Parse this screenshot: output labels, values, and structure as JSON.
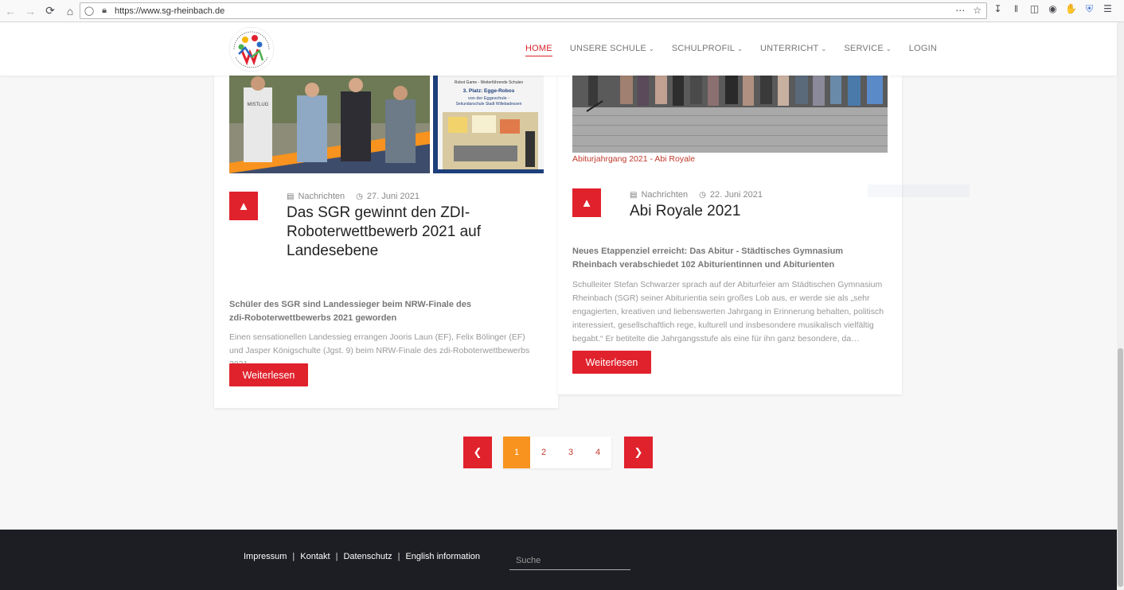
{
  "browser": {
    "url": "https://www.sg-rheinbach.de"
  },
  "nav": {
    "items": [
      {
        "label": "HOME",
        "active": true,
        "has_dropdown": false
      },
      {
        "label": "UNSERE SCHULE",
        "active": false,
        "has_dropdown": true
      },
      {
        "label": "SCHULPROFIL",
        "active": false,
        "has_dropdown": true
      },
      {
        "label": "UNTERRICHT",
        "active": false,
        "has_dropdown": true
      },
      {
        "label": "SERVICE",
        "active": false,
        "has_dropdown": true
      },
      {
        "label": "LOGIN",
        "active": false,
        "has_dropdown": false
      }
    ]
  },
  "articles": [
    {
      "category": "Nachrichten",
      "date": "27. Juni 2021",
      "title": "Das SGR gewinnt den ZDI-Roboterwettbewerb 2021 auf Landesebene",
      "lead": "Schüler des SGR sind Landessieger beim NRW-Finale des zdi-Roboterwettbewerbs 2021 geworden",
      "excerpt": "Einen sensationellen Landessieg errangen Jooris Laun (EF), Felix Bölinger (EF) und Jasper Königschulte (Jgst. 9) beim NRW-Finale des zdi-Roboterwettbewerbs 2021.",
      "button": "Weiterlesen",
      "image_caption": "",
      "poster_text": [
        "Robot Game - Weiterführende Schulen",
        "3. Platz: Egge-Robos",
        "von der Eggeschule -",
        "Sekundarschule Stadt Willebadessen"
      ],
      "shirt_text": "MISTLUG"
    },
    {
      "category": "Nachrichten",
      "date": "22. Juni 2021",
      "title": "Abi Royale 2021",
      "lead": "Neues Etappenziel erreicht: Das Abitur - Städtisches Gymnasium Rheinbach verabschiedet 102 Abiturientinnen und Abiturienten",
      "excerpt": "Schulleiter Stefan Schwarzer sprach auf der Abiturfeier am Städtischen Gymnasium Rheinbach (SGR) seiner Abiturientia sein großes Lob aus, er werde sie als „sehr engagierten, kreativen und liebenswerten Jahrgang in Erinnerung behalten, politisch interessiert, gesellschaftlich rege, kulturell und insbesondere musikalisch vielfältig begabt.“ Er betitelte die Jahrgangsstufe als eine für ihn ganz besondere, da…",
      "button": "Weiterlesen",
      "image_caption": "Abiturjahrgang 2021 - Abi Royale"
    }
  ],
  "pagination": {
    "pages": [
      "1",
      "2",
      "3",
      "4"
    ],
    "current": "1",
    "prev_icon": "chevron-left-icon",
    "next_icon": "chevron-right-icon"
  },
  "footer": {
    "links": [
      "Impressum",
      "Kontakt",
      "Datenschutz",
      "English information"
    ],
    "search_placeholder": "Suche"
  },
  "colors": {
    "accent": "#e0222d",
    "active_page": "#f7931e",
    "footer_bg": "#1d1e23"
  }
}
